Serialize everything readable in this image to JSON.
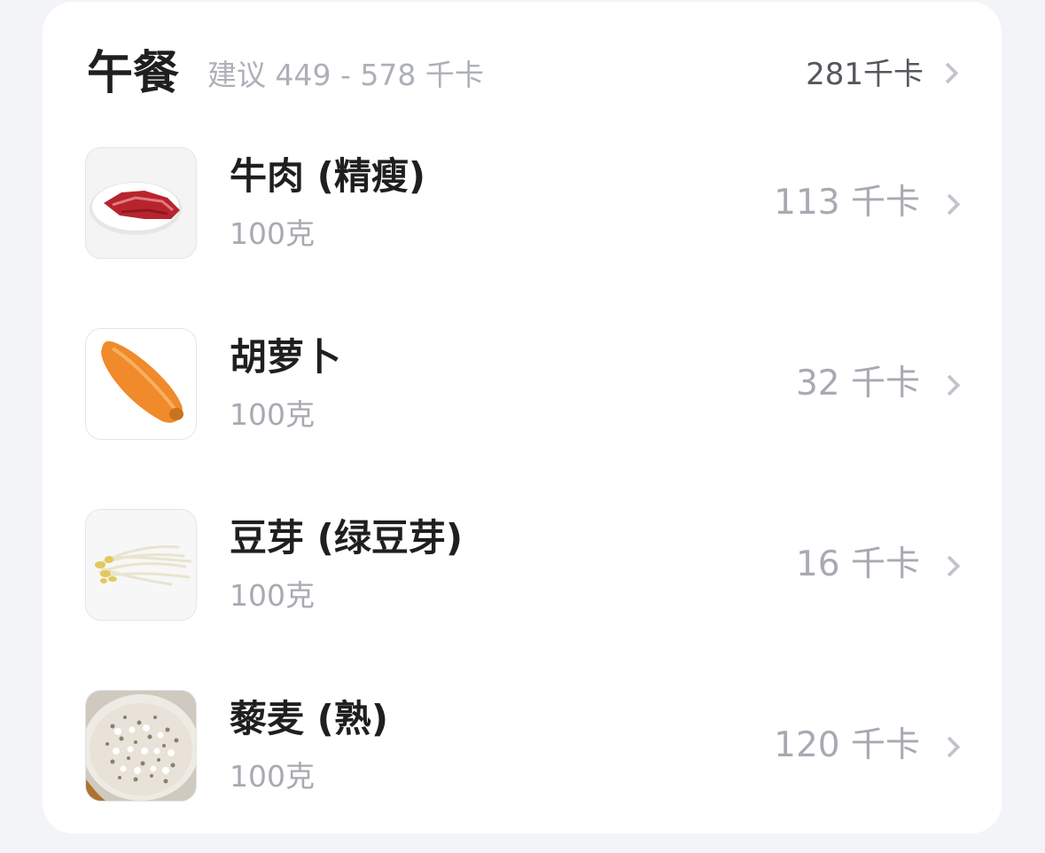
{
  "meal": {
    "title": "午餐",
    "suggestion": "建议 449 - 578 千卡",
    "total": "281千卡"
  },
  "foods": [
    {
      "name": "牛肉 (精瘦)",
      "amount": "100克",
      "kcal": "113 千卡",
      "image_icon": "beef-photo"
    },
    {
      "name": "胡萝卜",
      "amount": "100克",
      "kcal": "32 千卡",
      "image_icon": "carrot-photo"
    },
    {
      "name": "豆芽 (绿豆芽)",
      "amount": "100克",
      "kcal": "16 千卡",
      "image_icon": "bean-sprouts-photo"
    },
    {
      "name": "藜麦 (熟)",
      "amount": "100克",
      "kcal": "120 千卡",
      "image_icon": "quinoa-photo"
    }
  ],
  "colors": {
    "background": "#f3f4f8",
    "card": "#ffffff",
    "title_text": "#1f1f1f",
    "secondary_text": "#a8aab2",
    "chevron": "#c2c4cb"
  }
}
